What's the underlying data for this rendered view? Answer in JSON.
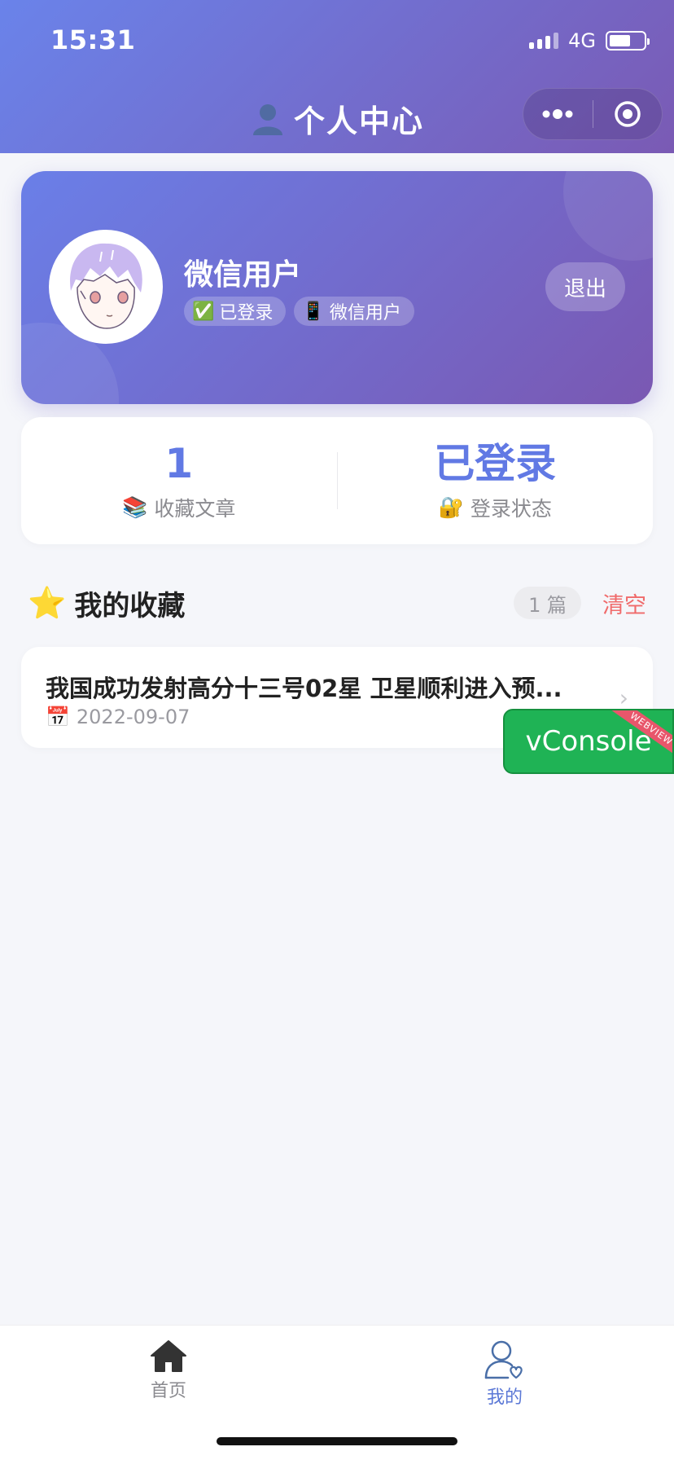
{
  "status_bar": {
    "time": "15:31",
    "network": "4G"
  },
  "nav": {
    "title": "个人中心"
  },
  "profile": {
    "name": "微信用户",
    "tags": [
      {
        "emoji": "✅",
        "label": "已登录"
      },
      {
        "emoji": "📱",
        "label": "微信用户"
      }
    ],
    "logout_label": "退出"
  },
  "stats": [
    {
      "value": "1",
      "emoji": "📚",
      "label": "收藏文章"
    },
    {
      "value": "已登录",
      "emoji": "🔐",
      "label": "登录状态"
    }
  ],
  "favorites": {
    "emoji": "⭐",
    "title": "我的收藏",
    "count": "1 篇",
    "clear_label": "清空",
    "items": [
      {
        "title": "我国成功发射高分十三号02星 卫星顺利进入预...",
        "emoji": "📅",
        "date": "2022-09-07"
      }
    ]
  },
  "vconsole": {
    "label": "vConsole",
    "ribbon": "WEBVIEW"
  },
  "tabbar": [
    {
      "label": "首页",
      "icon": "home-icon",
      "active": false
    },
    {
      "label": "我的",
      "icon": "user-heart-icon",
      "active": true
    }
  ],
  "colors": {
    "accent": "#6179e4",
    "danger": "#f06b6b",
    "vconsole": "#1fb355"
  }
}
